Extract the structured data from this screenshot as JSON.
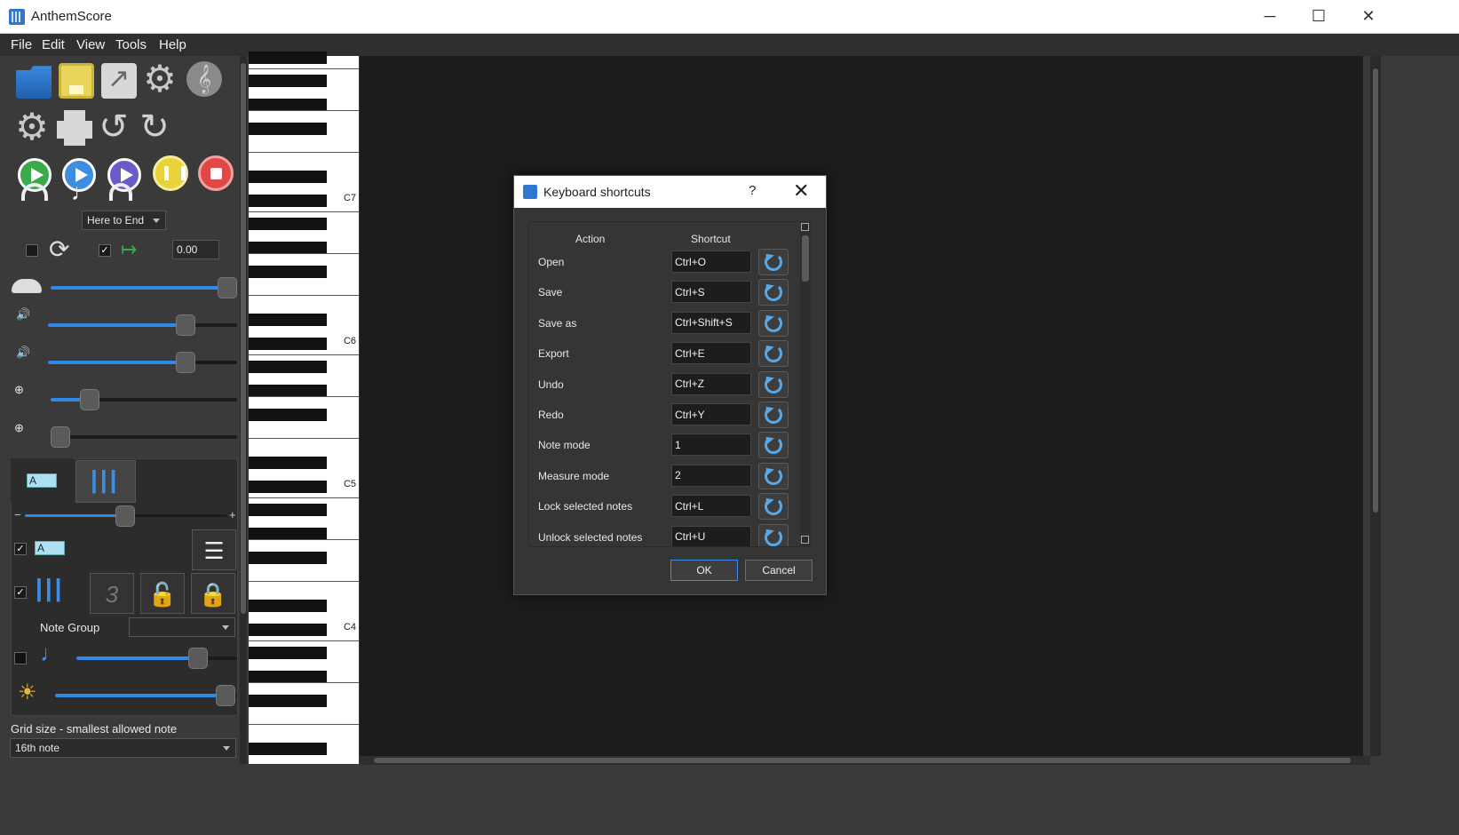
{
  "window": {
    "title": "AnthemScore",
    "minimize": "─",
    "maximize": "☐",
    "close": "✕"
  },
  "menu": [
    "File",
    "Edit",
    "View",
    "Tools",
    "Help"
  ],
  "toolbar": {
    "play_range": "Here to End",
    "playback_start": "0.00",
    "lyric_chip": "A",
    "note_group_label": "Note Group",
    "note_group_value": "",
    "grid_label": "Grid size - smallest allowed note",
    "grid_value": "16th note",
    "zoom_minus": "−",
    "zoom_plus": "+"
  },
  "piano": {
    "labels": [
      "C7",
      "C6",
      "C5",
      "C4"
    ]
  },
  "dialog": {
    "title": "Keyboard shortcuts",
    "help": "?",
    "close": "✕",
    "col_action": "Action",
    "col_shortcut": "Shortcut",
    "rows": [
      {
        "action": "Open",
        "shortcut": "Ctrl+O"
      },
      {
        "action": "Save",
        "shortcut": "Ctrl+S"
      },
      {
        "action": "Save as",
        "shortcut": "Ctrl+Shift+S"
      },
      {
        "action": "Export",
        "shortcut": "Ctrl+E"
      },
      {
        "action": "Undo",
        "shortcut": "Ctrl+Z"
      },
      {
        "action": "Redo",
        "shortcut": "Ctrl+Y"
      },
      {
        "action": "Note mode",
        "shortcut": "1"
      },
      {
        "action": "Measure mode",
        "shortcut": "2"
      },
      {
        "action": "Lock selected notes",
        "shortcut": "Ctrl+L"
      },
      {
        "action": "Unlock selected notes",
        "shortcut": "Ctrl+U"
      }
    ],
    "ok": "OK",
    "cancel": "Cancel"
  },
  "colors": {
    "accent": "#2e8ae6",
    "canvas": "#1c1c1c",
    "panel": "#3a3a3a"
  },
  "sliders": {
    "speed": 1.0,
    "headphone_volume": 0.68,
    "note_volume": 0.68,
    "vertical_zoom": 0.2,
    "horizontal_zoom": 0.02,
    "lyrics_zoom": 0.48,
    "note_volume_b": 0.8,
    "brightness": 1.0
  }
}
